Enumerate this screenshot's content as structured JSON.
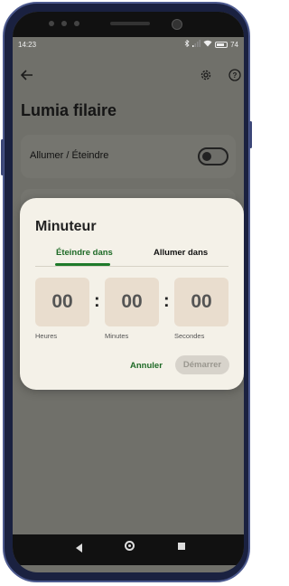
{
  "status_bar": {
    "time": "14:23",
    "battery_percent": "74"
  },
  "app_bar": {
    "back_icon": "arrow-left-icon",
    "settings_icon": "gear-icon",
    "help_icon": "help-icon"
  },
  "page": {
    "title": "Lumia filaire"
  },
  "power_card": {
    "label": "Allumer / Éteindre",
    "switch_on": false
  },
  "timer_dialog": {
    "title": "Minuteur",
    "tabs": [
      {
        "label": "Éteindre dans",
        "active": true
      },
      {
        "label": "Allumer dans",
        "active": false
      }
    ],
    "hours": {
      "value": "00",
      "label": "Heures"
    },
    "minutes": {
      "value": "00",
      "label": "Minutes"
    },
    "seconds": {
      "value": "00",
      "label": "Secondes"
    },
    "separator": ":",
    "cancel_label": "Annuler",
    "start_label": "Démarrer"
  },
  "colors": {
    "accent_green": "#1e6a26",
    "dialog_bg": "#f4f1e8",
    "time_box_bg": "#e9ddce",
    "scrim": "#70706a"
  }
}
